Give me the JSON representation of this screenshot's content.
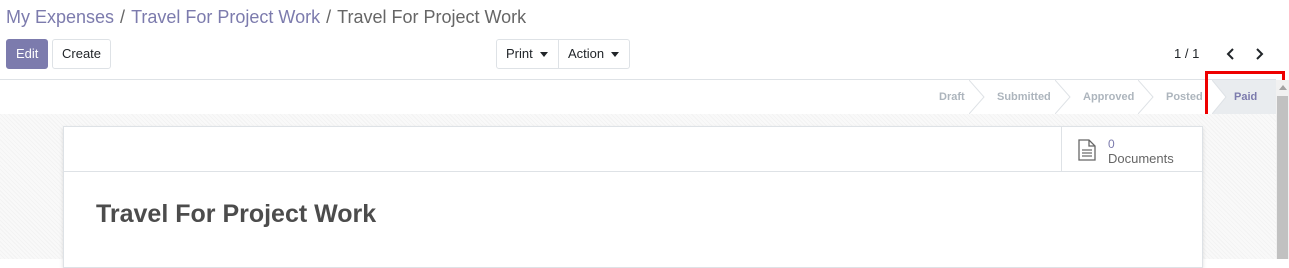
{
  "breadcrumb": {
    "items": [
      "My Expenses",
      "Travel For Project Work"
    ],
    "separator": "/",
    "current": "Travel For Project Work"
  },
  "toolbar": {
    "edit_label": "Edit",
    "create_label": "Create",
    "print_label": "Print",
    "action_label": "Action"
  },
  "pager": {
    "value": "1 / 1"
  },
  "statusbar": {
    "stages": [
      "Draft",
      "Submitted",
      "Approved",
      "Posted",
      "Paid"
    ],
    "active": "Paid"
  },
  "smart_button": {
    "count": "0",
    "label": "Documents",
    "icon": "document-icon"
  },
  "record": {
    "title": "Travel For Project Work"
  },
  "colors": {
    "brand": "#7c7bad",
    "highlight": "#e00000"
  }
}
